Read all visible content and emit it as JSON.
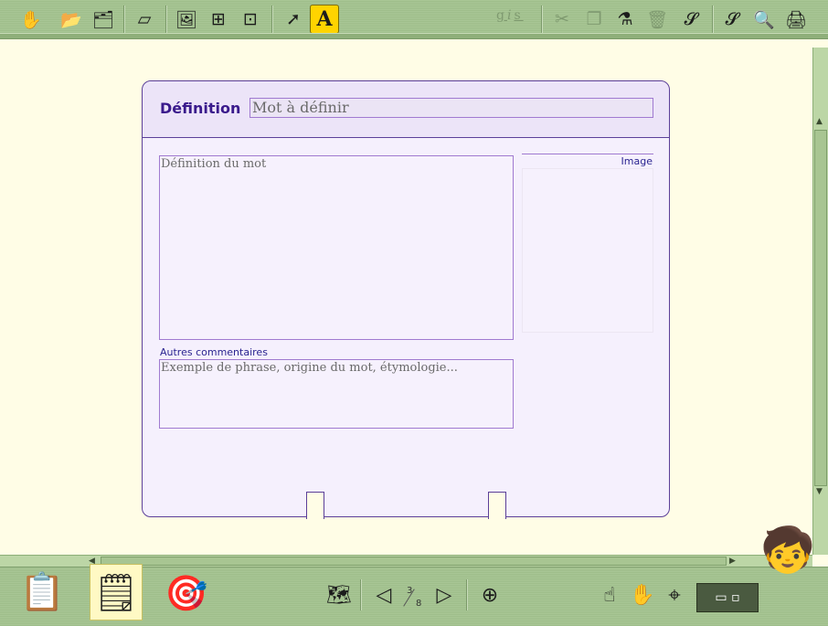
{
  "toolbar": {
    "icons": [
      "puzzle-icon",
      "open-folder-icon",
      "folder-menu-icon",
      "blank-page-icon",
      "insert-image-icon",
      "add-image-frame-icon",
      "add-text-frame-icon",
      "pointer-arrow-icon",
      "text-mode-icon",
      "gis-format-icon",
      "scissors-icon",
      "copy-icon",
      "paste-glue-icon",
      "trash-icon",
      "spiral-menu-icon",
      "spiral-icon",
      "magnifier-icon",
      "printer-icon"
    ],
    "text_mode_glyph": "A",
    "format": {
      "bold": "g",
      "italic": "i",
      "underline": "s"
    }
  },
  "card": {
    "title": "Définition",
    "word_placeholder": "Mot à définir",
    "definition_placeholder": "Définition du mot",
    "image_label": "Image",
    "comments_label": "Autres commentaires",
    "comments_placeholder": "Exemple de phrase, origine du mot, étymologie..."
  },
  "pager": {
    "current": "3",
    "total": "8"
  },
  "colors": {
    "toolbar": "#a9c796",
    "page_bg": "#fffde6",
    "card_bg": "#f5f0fd",
    "card_border": "#5b3f99",
    "label": "#3a1a8c",
    "highlight": "#ffd400"
  }
}
